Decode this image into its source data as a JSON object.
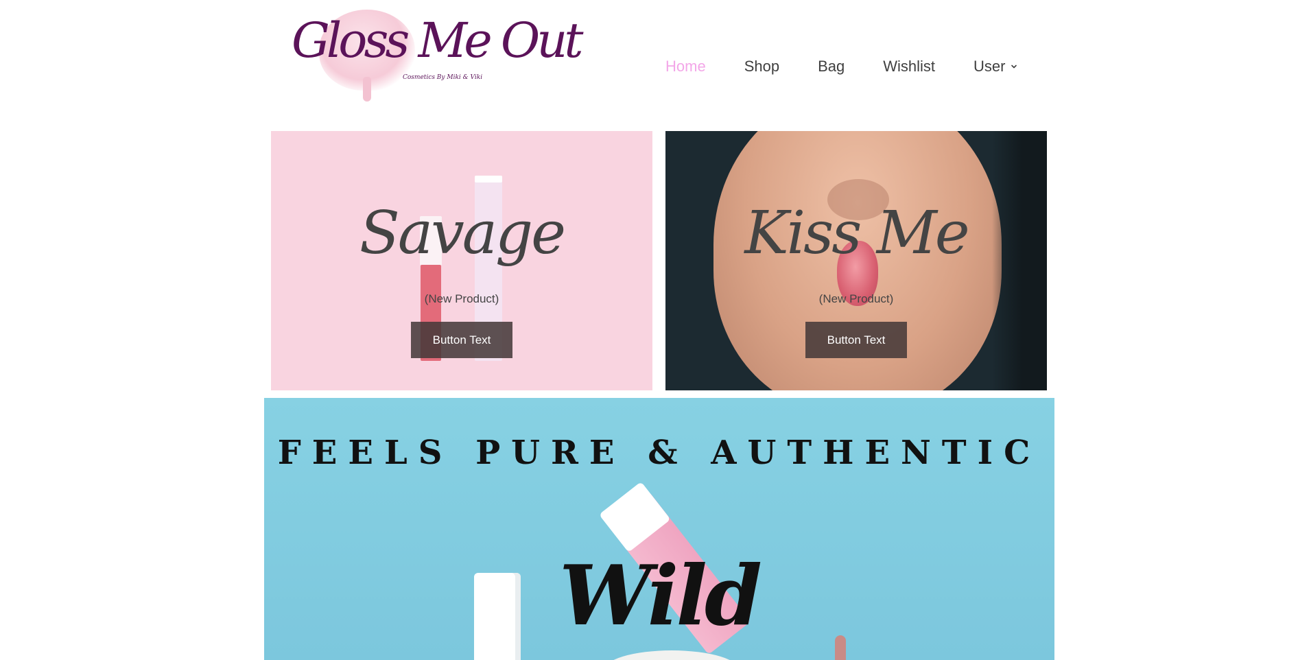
{
  "brand": {
    "logo_text": "Gloss Me Out",
    "tagline": "Cosmetics By Miki & Viki"
  },
  "nav": {
    "items": [
      {
        "label": "Home",
        "active": true
      },
      {
        "label": "Shop",
        "active": false
      },
      {
        "label": "Bag",
        "active": false
      },
      {
        "label": "Wishlist",
        "active": false
      },
      {
        "label": "User",
        "active": false,
        "has_dropdown": true
      }
    ],
    "active_color": "#f3a6e8",
    "text_color": "#3f3f3f"
  },
  "tiles": [
    {
      "title": "Savage",
      "subtitle": "(New Product)",
      "button_label": "Button Text",
      "background": "#f9d4e0"
    },
    {
      "title": "Kiss Me",
      "subtitle": "(New Product)",
      "button_label": "Button Text",
      "background": "#1c2a31"
    }
  ],
  "banner": {
    "heading": "FEELS PURE & AUTHENTIC",
    "script_text": "Wild",
    "background": "#87d1e3"
  }
}
